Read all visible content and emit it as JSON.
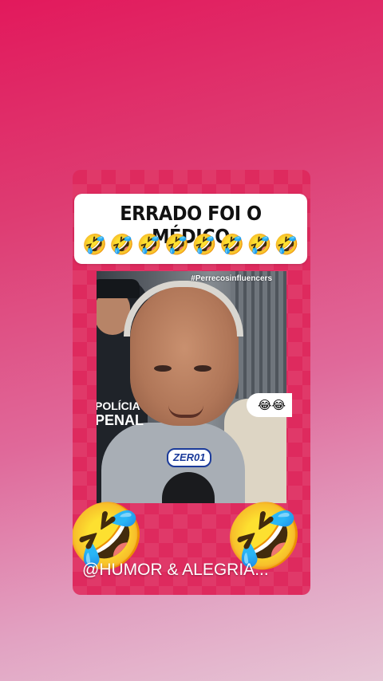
{
  "post": {
    "caption_title": "ERRADO FOI O MÉDICO",
    "caption_emojis": [
      "🤣",
      "🤣",
      "🤣",
      "🤣",
      "🤣",
      "🤣",
      "🤣",
      "🤣"
    ],
    "video": {
      "hashtag": "#Perrecosinfluencers",
      "vest_line1": "POLÍCIA",
      "vest_line2": "PENAL",
      "logo_text": "ZER01"
    },
    "reaction_bubble": "😂😂",
    "big_emoji_left": "🤣",
    "big_emoji_right": "🤣",
    "handle": "@HUMOR & ALEGRIA..."
  },
  "colors": {
    "background_top": "#e2195c",
    "background_bottom": "#e6c6d6",
    "card": "#de2a5e",
    "caption_box": "#ffffff"
  }
}
